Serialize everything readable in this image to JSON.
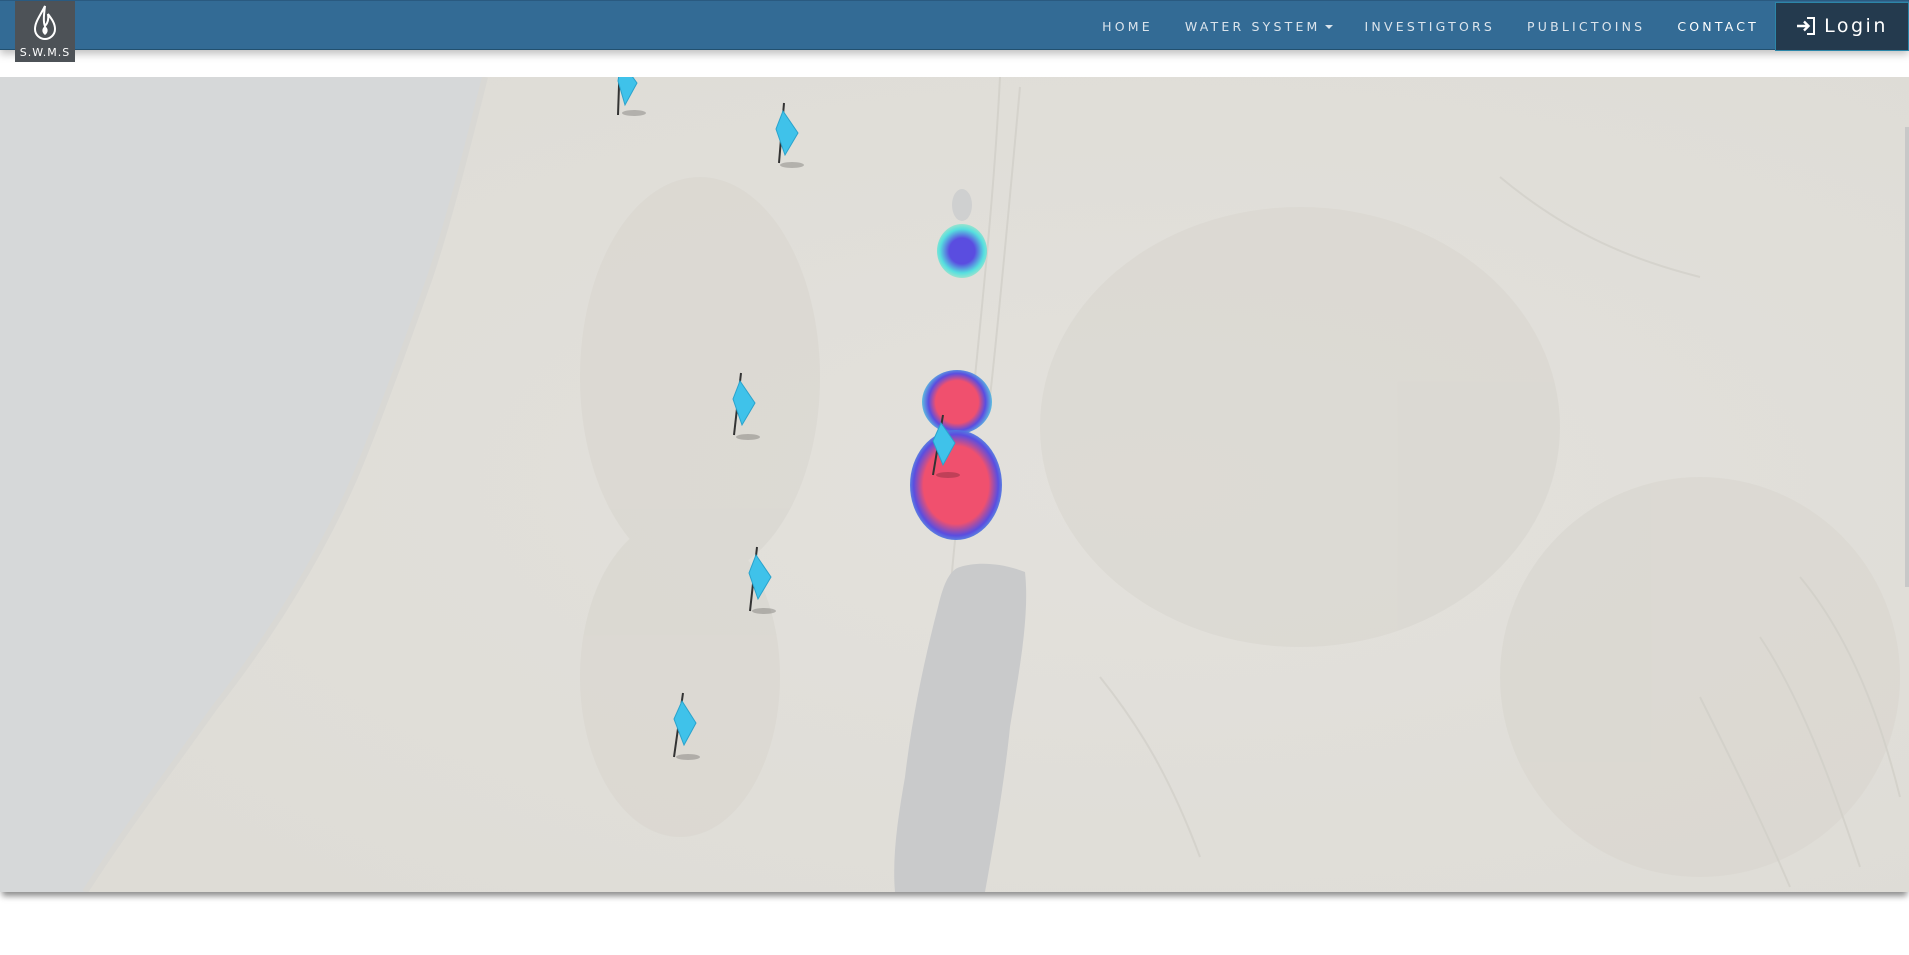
{
  "brand": {
    "logo_text": "S.W.M.S",
    "icon": "water-drop-icon"
  },
  "nav": {
    "items": [
      {
        "label": "HOME"
      },
      {
        "label": "WATER SYSTEM"
      },
      {
        "label": "INVESTIGTORS"
      },
      {
        "label": "PUBLICTOINS"
      },
      {
        "label": "CONTACT"
      }
    ],
    "login_label": "Login",
    "login_icon": "sign-in-icon"
  },
  "map": {
    "marker_icon": "flag-marker-icon",
    "marker_count": 6,
    "heatmap_colors": {
      "high": "#f0506e",
      "mid": "#5a4de0",
      "low": "#3ee0e0"
    },
    "colors": {
      "sea": "#d6d8d9",
      "land": "#e5e3df",
      "dead_sea": "#c9cacb"
    }
  },
  "colors": {
    "navbar": "#336b95",
    "login_bg": "#243a4e",
    "marker": "#3fc2ea"
  }
}
